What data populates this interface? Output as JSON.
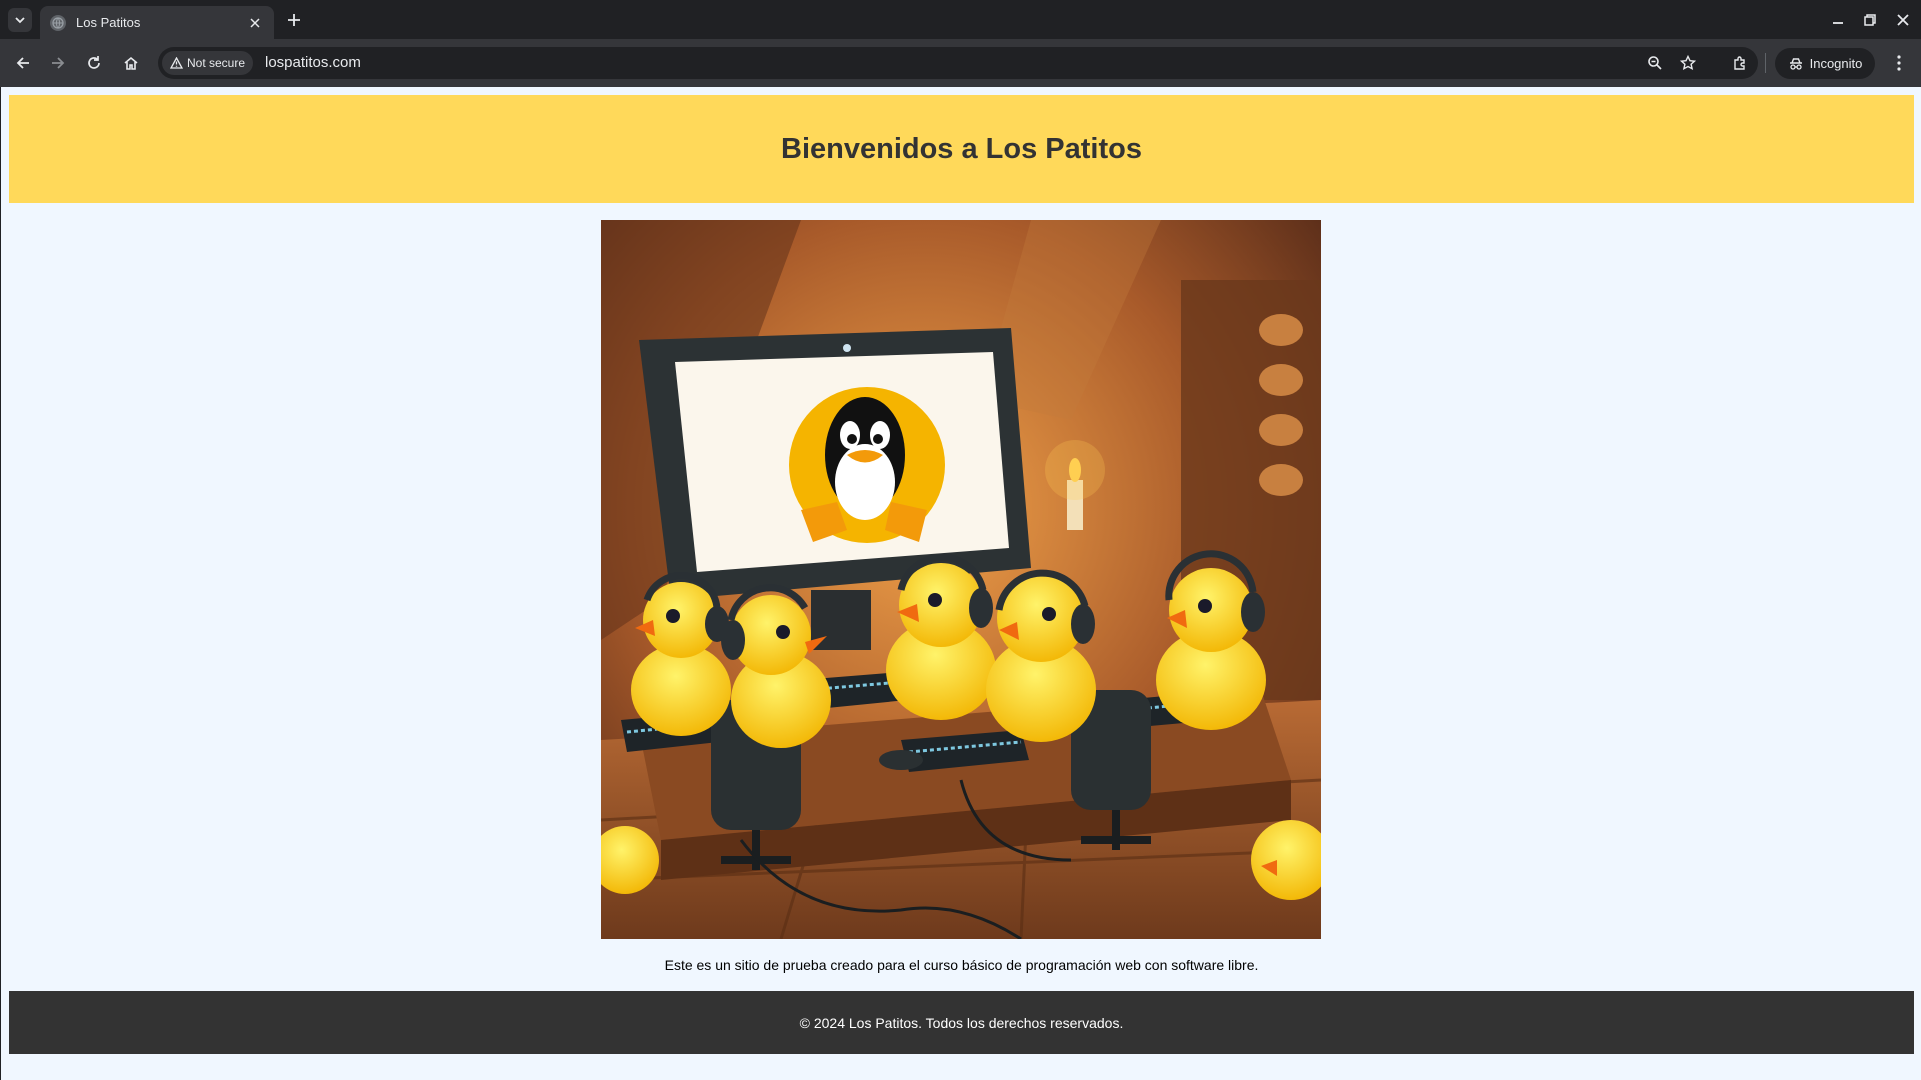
{
  "browser": {
    "tab_title": "Los Patitos",
    "security_label": "Not secure",
    "url": "lospatitos.com",
    "profile_label": "Incognito"
  },
  "page": {
    "header_title": "Bienvenidos a Los Patitos",
    "hero_image_alt": "Patitos con auriculares frente a computadoras con el pingüino de Linux",
    "caption": "Este es un sitio de prueba creado para el curso básico de programación web con software libre.",
    "footer": "© 2024 Los Patitos. Todos los derechos reservados."
  },
  "colors": {
    "header_bg": "#ffd95a",
    "footer_bg": "#333333",
    "page_bg": "#f0f7ff"
  }
}
